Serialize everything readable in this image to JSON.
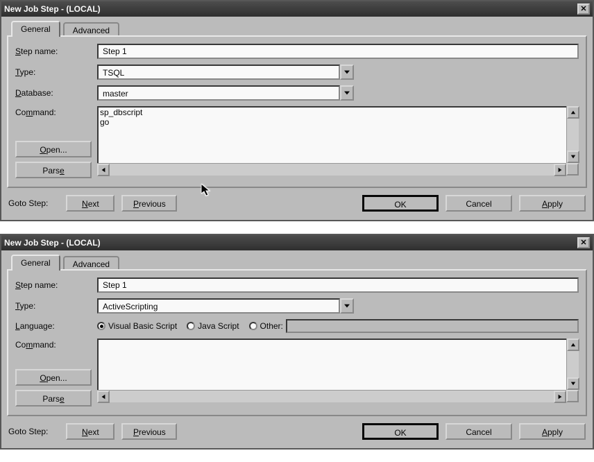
{
  "dialog1": {
    "title": "New Job Step - (LOCAL)",
    "tabs": {
      "general": "General",
      "advanced": "Advanced"
    },
    "labels": {
      "step_name": "Step name:",
      "step_name_u": "S",
      "type": "Type:",
      "type_u": "T",
      "database": "Database:",
      "database_u": "D",
      "command": "Command:",
      "command_u": "C"
    },
    "values": {
      "step_name": "Step 1",
      "type": "TSQL",
      "database": "master",
      "command": "sp_dbscript\ngo"
    },
    "buttons": {
      "open": "Open...",
      "open_u": "O",
      "parse": "Parse",
      "parse_u": "e",
      "next": "Next",
      "next_u": "N",
      "previous": "Previous",
      "previous_u": "P",
      "ok": "OK",
      "cancel": "Cancel",
      "apply": "Apply",
      "apply_u": "A"
    },
    "goto": "Goto Step:"
  },
  "dialog2": {
    "title": "New Job Step - (LOCAL)",
    "tabs": {
      "general": "General",
      "advanced": "Advanced"
    },
    "labels": {
      "step_name": "Step name:",
      "step_name_u": "S",
      "type": "Type:",
      "type_u": "T",
      "language": "Language:",
      "language_u": "L",
      "command": "Command:",
      "command_u": "C"
    },
    "values": {
      "step_name": "Step 1",
      "type": "ActiveScripting",
      "command": ""
    },
    "radios": {
      "vbs": "Visual Basic Script",
      "vbs_u": "V",
      "js": "Java Script",
      "js_u": "J",
      "other": "Other:",
      "other_u": "r"
    },
    "buttons": {
      "open": "Open...",
      "open_u": "O",
      "parse": "Parse",
      "parse_u": "e",
      "next": "Next",
      "next_u": "N",
      "previous": "Previous",
      "previous_u": "P",
      "ok": "OK",
      "cancel": "Cancel",
      "apply": "Apply",
      "apply_u": "A"
    },
    "goto": "Goto Step:"
  }
}
